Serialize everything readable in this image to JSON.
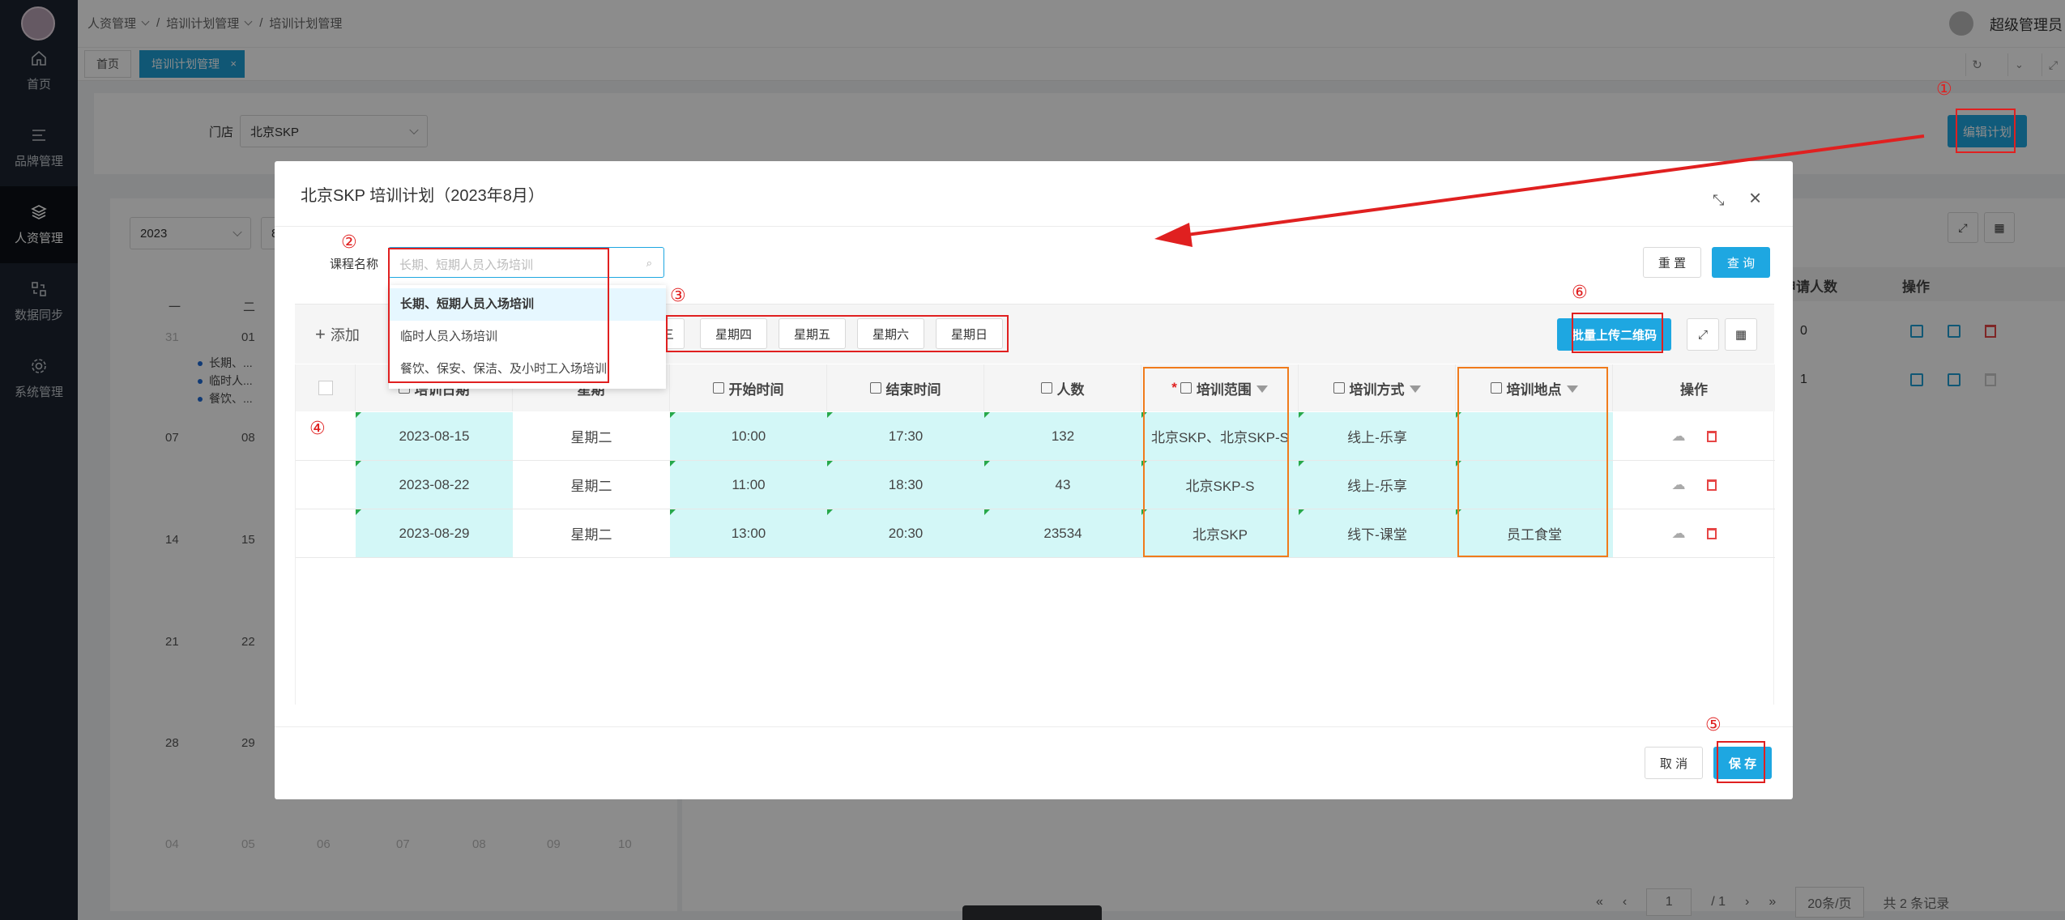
{
  "sidebar": {
    "items": [
      {
        "label": "首页",
        "icon": "home-icon"
      },
      {
        "label": "品牌管理",
        "icon": "menu-icon"
      },
      {
        "label": "人资管理",
        "icon": "layers-icon"
      },
      {
        "label": "数据同步",
        "icon": "sync-icon"
      },
      {
        "label": "系统管理",
        "icon": "gear-icon"
      }
    ],
    "active_index": 2
  },
  "breadcrumb": {
    "items": [
      "人资管理",
      "培训计划管理",
      "培训计划管理"
    ]
  },
  "user": {
    "name": "超级管理员"
  },
  "tabs": [
    {
      "label": "首页",
      "active": false
    },
    {
      "label": "培训计划管理",
      "active": true
    }
  ],
  "filter": {
    "store_label": "门店",
    "store_value": "北京SKP",
    "edit_button": "编辑计划"
  },
  "calendar": {
    "year": "2023",
    "month_partial": "8",
    "weekdays": [
      "一",
      "二"
    ],
    "rows": [
      [
        "31",
        "01"
      ],
      [
        "07",
        "08"
      ],
      [
        "14",
        "15"
      ],
      [
        "21",
        "22"
      ],
      [
        "28",
        "29"
      ],
      [
        "04",
        "05",
        "06",
        "07",
        "08",
        "09",
        "10"
      ]
    ],
    "events": [
      "长期、...",
      "临时人...",
      "餐饮、..."
    ]
  },
  "right_table": {
    "header_partial": "申请人数",
    "header_action": "操作",
    "values": [
      "0",
      "1"
    ]
  },
  "pager": {
    "page": "1",
    "total_pages": "/ 1",
    "page_size": "20条/页",
    "total": "共 2 条记录"
  },
  "modal": {
    "title": "北京SKP 培训计划（2023年8月）",
    "course_label": "课程名称",
    "course_placeholder": "长期、短期人员入场培训",
    "reset_button": "重 置",
    "search_button": "查 询",
    "add_button": "添加",
    "weekday_buttons": [
      "三",
      "星期四",
      "星期五",
      "星期六",
      "星期日"
    ],
    "batch_upload_button": "批量上传二维码",
    "dropdown_options": [
      "长期、短期人员入场培训",
      "临时人员入场培训",
      "餐饮、保安、保洁、及小时工入场培训"
    ],
    "columns": {
      "date": "培训日期",
      "weekday": "星期",
      "start": "开始时间",
      "end": "结束时间",
      "count": "人数",
      "scope": "培训范围",
      "mode": "培训方式",
      "place": "培训地点",
      "action": "操作"
    },
    "rows": [
      {
        "date": "2023-08-15",
        "weekday": "星期二",
        "start": "10:00",
        "end": "17:30",
        "count": "132",
        "scope": "北京SKP、北京SKP-S",
        "mode": "线上-乐享",
        "place": ""
      },
      {
        "date": "2023-08-22",
        "weekday": "星期二",
        "start": "11:00",
        "end": "18:30",
        "count": "43",
        "scope": "北京SKP-S",
        "mode": "线上-乐享",
        "place": ""
      },
      {
        "date": "2023-08-29",
        "weekday": "星期二",
        "start": "13:00",
        "end": "20:30",
        "count": "23534",
        "scope": "北京SKP",
        "mode": "线下-课堂",
        "place": "员工食堂"
      }
    ],
    "cancel_button": "取 消",
    "save_button": "保 存"
  },
  "annotations": [
    "①",
    "②",
    "③",
    "④",
    "⑤",
    "⑥"
  ],
  "colors": {
    "accent": "#1ea7e1",
    "sidebar": "#1c2431",
    "highlight_cell": "#d3f7f7",
    "annotation_red": "#e02020",
    "annotation_orange": "#f07b1c"
  }
}
